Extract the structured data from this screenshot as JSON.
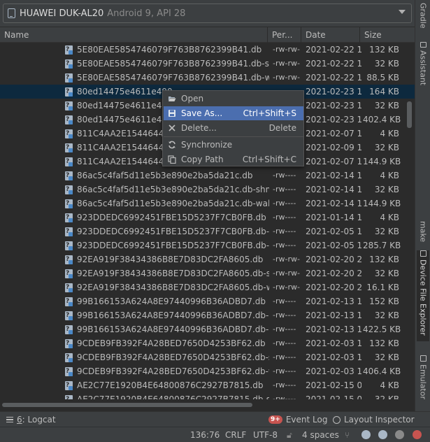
{
  "device": {
    "name": "HUAWEI DUK-AL20",
    "api": "Android 9, API 28"
  },
  "table": {
    "columns": [
      "Name",
      "Per...",
      "Date",
      "Size"
    ],
    "rows": [
      {
        "name": "5E80EAE5854746079F763B8762399B41.db",
        "perm": "-rw-rw-",
        "date": "2021-02-22 1",
        "size": "132 KB"
      },
      {
        "name": "5E80EAE5854746079F763B8762399B41.db-shm",
        "perm": "-rw-rw-",
        "date": "2021-02-22 1",
        "size": "32 KB"
      },
      {
        "name": "5E80EAE5854746079F763B8762399B41.db-wal",
        "perm": "-rw-rw-",
        "date": "2021-02-22 1",
        "size": "88.5 KB"
      },
      {
        "name": "80ed14475e4611e490",
        "perm": "",
        "date": "2021-02-23 1",
        "size": "164 KB"
      },
      {
        "name": "80ed14475e4611e490",
        "perm": "",
        "date": "2021-02-23 1",
        "size": "32 KB"
      },
      {
        "name": "80ed14475e4611e490",
        "perm": "",
        "date": "2021-02-23 1",
        "size": "402.4 KB"
      },
      {
        "name": "811C4AA2E15446449",
        "perm": "",
        "date": "2021-02-07 1",
        "size": "4 KB"
      },
      {
        "name": "811C4AA2E15446449",
        "perm": "",
        "date": "2021-02-09 1",
        "size": "32 KB"
      },
      {
        "name": "811C4AA2E15446449",
        "perm": "",
        "date": "2021-02-07 1",
        "size": "144.9 KB"
      },
      {
        "name": "86ac5c4faf5d11e5b3e890e2ba5da21c.db",
        "perm": "-rw----",
        "date": "2021-02-14 1",
        "size": "4 KB"
      },
      {
        "name": "86ac5c4faf5d11e5b3e890e2ba5da21c.db-shm",
        "perm": "-rw----",
        "date": "2021-02-14 1",
        "size": "32 KB"
      },
      {
        "name": "86ac5c4faf5d11e5b3e890e2ba5da21c.db-wal",
        "perm": "-rw----",
        "date": "2021-02-14 1",
        "size": "144.9 KB"
      },
      {
        "name": "923DDEDC6992451FBE15D5237F7CB0FB.db",
        "perm": "-rw----",
        "date": "2021-01-14 1",
        "size": "4 KB"
      },
      {
        "name": "923DDEDC6992451FBE15D5237F7CB0FB.db-shm",
        "perm": "-rw----",
        "date": "2021-02-05 1",
        "size": "32 KB"
      },
      {
        "name": "923DDEDC6992451FBE15D5237F7CB0FB.db-wal",
        "perm": "-rw----",
        "date": "2021-02-05 1",
        "size": "285.7 KB"
      },
      {
        "name": "92EA919F38434386B8E7D83DC2FA8605.db",
        "perm": "-rw-rw-",
        "date": "2021-02-20 2",
        "size": "132 KB"
      },
      {
        "name": "92EA919F38434386B8E7D83DC2FA8605.db-shm",
        "perm": "-rw-rw-",
        "date": "2021-02-20 2",
        "size": "32 KB"
      },
      {
        "name": "92EA919F38434386B8E7D83DC2FA8605.db-wal",
        "perm": "-rw-rw-",
        "date": "2021-02-20 2",
        "size": "16.1 KB"
      },
      {
        "name": "99B166153A624A8E97440996B36ADBD7.db",
        "perm": "-rw----",
        "date": "2021-02-13 1",
        "size": "152 KB"
      },
      {
        "name": "99B166153A624A8E97440996B36ADBD7.db-shm",
        "perm": "-rw----",
        "date": "2021-02-13 1",
        "size": "32 KB"
      },
      {
        "name": "99B166153A624A8E97440996B36ADBD7.db-wal",
        "perm": "-rw----",
        "date": "2021-02-13 1",
        "size": "422.5 KB"
      },
      {
        "name": "9CDEB9FB392F4A28BED7650D4253BF62.db",
        "perm": "-rw----",
        "date": "2021-02-03 1",
        "size": "132 KB"
      },
      {
        "name": "9CDEB9FB392F4A28BED7650D4253BF62.db-shm",
        "perm": "-rw----",
        "date": "2021-02-03 1",
        "size": "32 KB"
      },
      {
        "name": "9CDEB9FB392F4A28BED7650D4253BF62.db-wal",
        "perm": "-rw----",
        "date": "2021-02-03 1",
        "size": "406.4 KB"
      },
      {
        "name": "AE2C77E1920B4E64800876C2927B7815.db",
        "perm": "-rw----",
        "date": "2021-02-15 0",
        "size": "4 KB"
      },
      {
        "name": "AE2C77E1920B4E64800876C2927B7815.db-shm",
        "perm": "-rw----",
        "date": "2021-02-15 0",
        "size": "32 KB"
      }
    ]
  },
  "context_menu": {
    "items": [
      {
        "label": "Open",
        "shortcut": "",
        "icon": "folder-open-icon"
      },
      {
        "label": "Save As...",
        "shortcut": "Ctrl+Shift+S",
        "icon": "save-icon"
      },
      {
        "label": "Delete...",
        "shortcut": "Delete",
        "icon": "delete-icon"
      },
      {
        "label": "Synchronize",
        "shortcut": "",
        "icon": "sync-icon"
      },
      {
        "label": "Copy Path",
        "shortcut": "Ctrl+Shift+C",
        "icon": "copy-icon"
      }
    ]
  },
  "right_tabs": {
    "gradle": "Gradle",
    "assistant": "Assistant",
    "make": "make",
    "device_file_explorer": "Device File Explorer",
    "emulator": "Emulator"
  },
  "bottom_tabs": {
    "logcat_num": "6",
    "logcat_label": ": Logcat",
    "event_badge": "9+",
    "event_log": "Event Log",
    "layout_inspector": "Layout Inspector"
  },
  "status": {
    "position": "136:76",
    "line_sep": "CRLF",
    "encoding": "UTF-8",
    "indent": "4 spaces"
  },
  "colors": {
    "selected_row": "#0d293e",
    "menu_highlight": "#4b6eaf",
    "error": "#c75450"
  }
}
